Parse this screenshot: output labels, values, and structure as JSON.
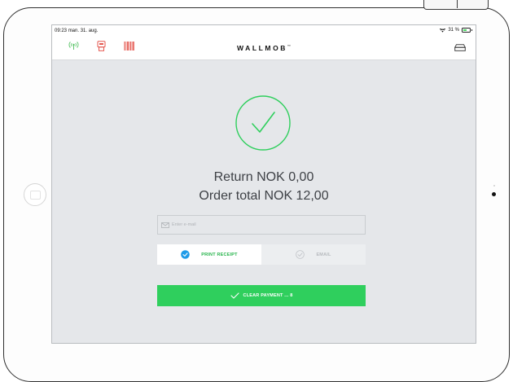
{
  "status": {
    "time": "09:23",
    "date": "man. 31. aug.",
    "battery": "31 %"
  },
  "header": {
    "logo": "WALLMOB",
    "logo_mark": "™",
    "icons": [
      "wireless-signal-icon",
      "receipt-printer-icon",
      "barcode-scanner-icon",
      "cash-drawer-icon"
    ]
  },
  "payment": {
    "return_text": "Return NOK 0,00",
    "order_total_text": "Order total  NOK 12,00"
  },
  "receipt": {
    "email_placeholder": "Enter e-mail",
    "email_value": "",
    "print_label": "PRINT RECEIPT",
    "email_label": "EMAIL",
    "selected": "print"
  },
  "actions": {
    "clear_label": "CLEAR PAYMENT ... 8"
  },
  "colors": {
    "accent_green": "#2fcf5d",
    "selected_blue": "#1e9be8",
    "screen_bg": "#e5e7ea"
  }
}
